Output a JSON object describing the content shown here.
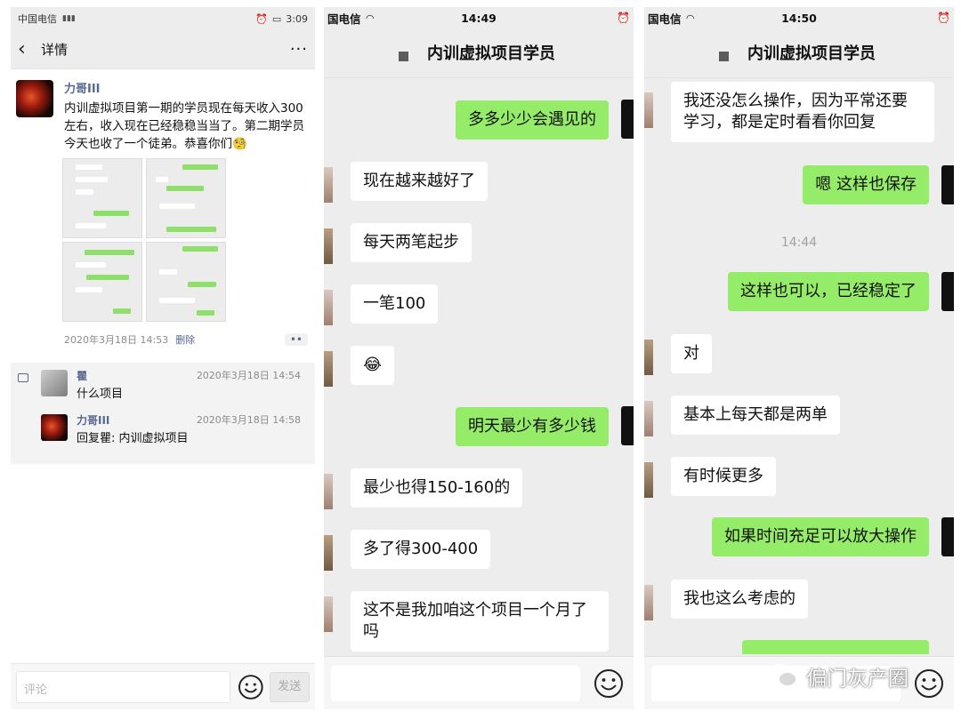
{
  "moment": {
    "status": {
      "carrier": "中国电信",
      "time": "3:09"
    },
    "nav": {
      "title": "详情"
    },
    "post": {
      "author": "力哥III",
      "text": "内训虚拟项目第一期的学员现在每天收入300左右，收入现在已经稳稳当当了。第二期学员今天也收了一个徒弟。恭喜你们🧐",
      "time": "2020年3月18日 14:53",
      "delete": "删除"
    },
    "comments": [
      {
        "name": "瞿",
        "time": "2020年3月18日 14:54",
        "text": "什么项目"
      },
      {
        "name": "力哥III",
        "time": "2020年3月18日 14:58",
        "text": "回复瞿: 内训虚拟项目"
      }
    ],
    "input": {
      "placeholder": "评论",
      "send": "发送"
    }
  },
  "chat1": {
    "status": {
      "carrier": "国电信",
      "time": "14:49"
    },
    "title": "内训虚拟项目学员",
    "messages": [
      {
        "dir": "out",
        "text": "多多少少会遇见的"
      },
      {
        "dir": "in",
        "text": "现在越来越好了"
      },
      {
        "dir": "in",
        "text": "每天两笔起步"
      },
      {
        "dir": "in",
        "text": "一笔100"
      },
      {
        "dir": "in",
        "text": "😂"
      },
      {
        "dir": "out",
        "text": "明天最少有多少钱"
      },
      {
        "dir": "in",
        "text": "最少也得150-160的"
      },
      {
        "dir": "in",
        "text": "多了得300-400"
      },
      {
        "dir": "in",
        "text": "这不是我加咱这个项目一个月了吗"
      }
    ]
  },
  "chat2": {
    "status": {
      "carrier": "国电信",
      "time": "14:50"
    },
    "title": "内训虚拟项目学员",
    "messages": [
      {
        "dir": "in",
        "text": "我还没怎么操作，因为平常还要学习，都是定时看看你回复"
      },
      {
        "dir": "out",
        "text": "嗯 这样也保存"
      },
      {
        "dir": "out",
        "text": "这样也可以，已经稳定了"
      },
      {
        "dir": "in",
        "text": "对"
      },
      {
        "dir": "in",
        "text": "基本上每天都是两单"
      },
      {
        "dir": "in",
        "text": "有时候更多"
      },
      {
        "dir": "out",
        "text": "如果时间充足可以放大操作"
      },
      {
        "dir": "in",
        "text": "我也这么考虑的"
      }
    ],
    "timestamp": "14:44"
  },
  "watermark": "偏门灰产圈",
  "colors": {
    "bubble_out": "#95ec69",
    "bubble_in": "#ffffff",
    "chat_bg": "#ededed",
    "link_blue": "#57698f"
  }
}
